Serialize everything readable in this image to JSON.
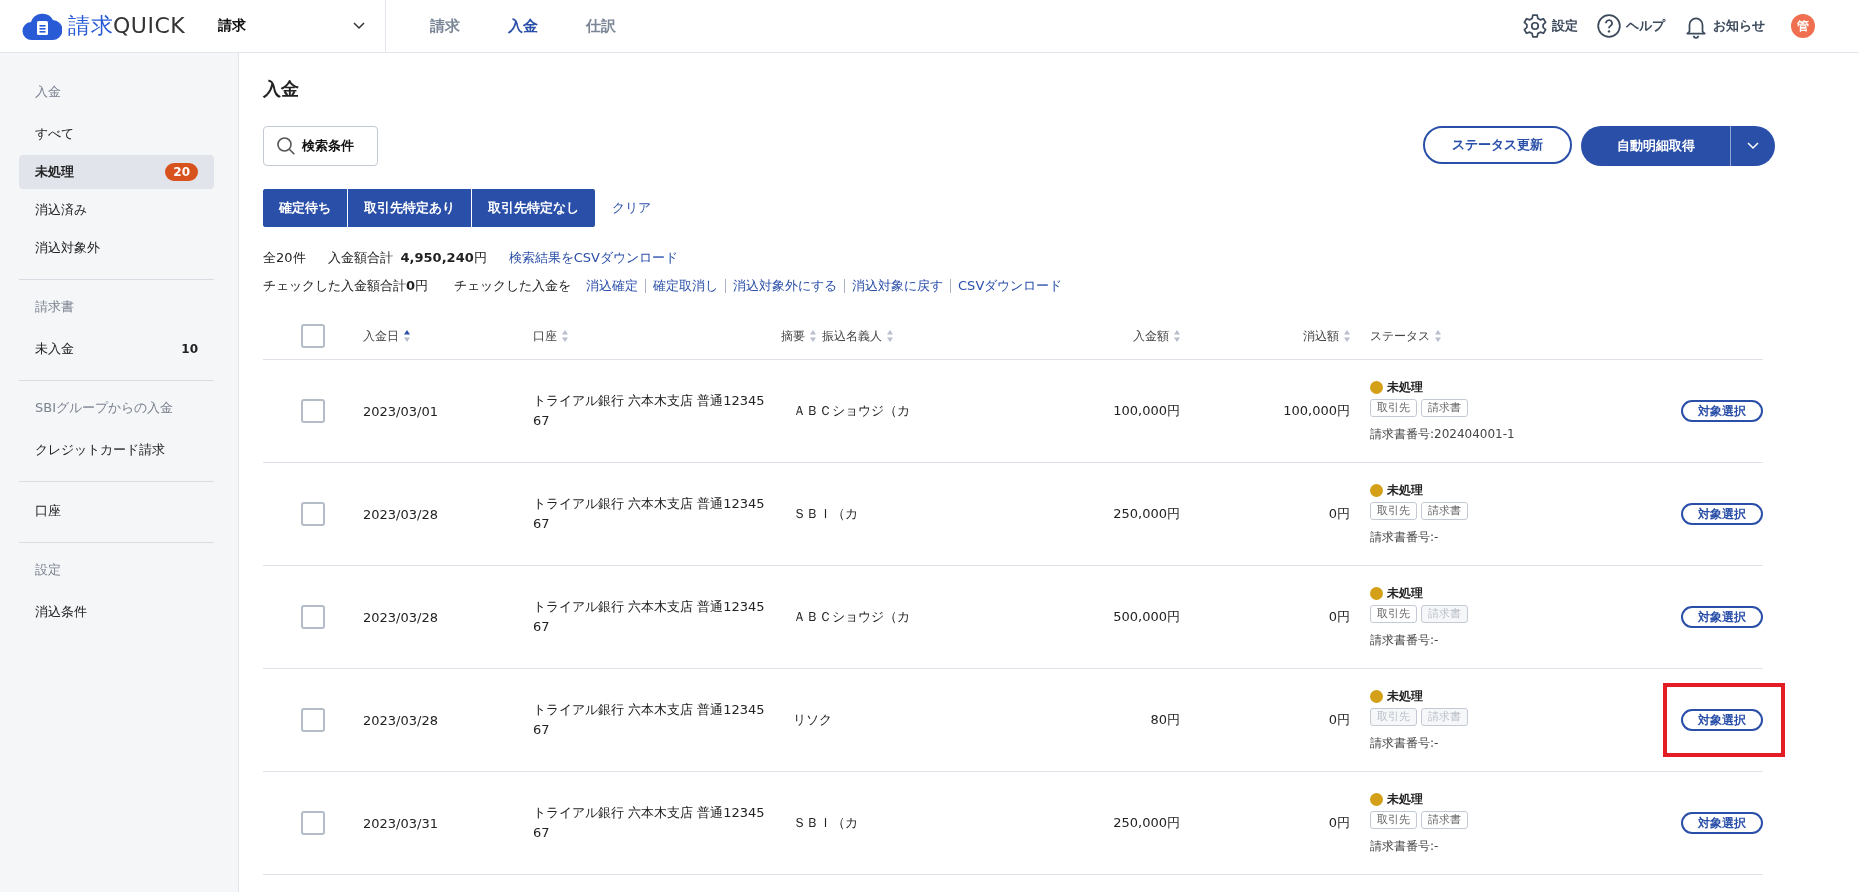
{
  "header": {
    "logo_primary": "請求",
    "logo_secondary": "QUICK",
    "product_select": "請求",
    "nav": [
      {
        "label": "請求",
        "selected": false
      },
      {
        "label": "入金",
        "selected": true
      },
      {
        "label": "仕訳",
        "selected": false
      }
    ],
    "actions": [
      {
        "kind": "settings",
        "label": "設定"
      },
      {
        "kind": "help",
        "label": "ヘルプ"
      },
      {
        "kind": "bell",
        "label": "お知らせ"
      }
    ],
    "avatar": "管"
  },
  "sidebar": {
    "sections": [
      {
        "heading": "入金",
        "items": [
          {
            "label": "すべて",
            "selected": false
          },
          {
            "label": "未処理",
            "selected": true,
            "badge": "20"
          },
          {
            "label": "消込済み",
            "selected": false
          },
          {
            "label": "消込対象外",
            "selected": false
          }
        ]
      },
      {
        "heading": "請求書",
        "items": [
          {
            "label": "未入金",
            "selected": false,
            "count": "10"
          }
        ]
      },
      {
        "heading": "SBIグループからの入金",
        "items": [
          {
            "label": "クレジットカード請求",
            "selected": false
          }
        ]
      },
      {
        "items": [
          {
            "label": "口座",
            "selected": false
          }
        ]
      },
      {
        "heading": "設定",
        "items": [
          {
            "label": "消込条件",
            "selected": false
          }
        ]
      }
    ]
  },
  "page_title": "入金",
  "search_button": "検索条件",
  "status_update_button": "ステータス更新",
  "auto_fetch_button": "自動明細取得",
  "filters": [
    {
      "label": "確定待ち",
      "selected": true
    },
    {
      "label": "取引先特定あり",
      "selected": true
    },
    {
      "label": "取引先特定なし",
      "selected": true
    }
  ],
  "clear_link": "クリア",
  "summary": {
    "total_count": "全20件",
    "amount_label": "入金額合計",
    "amount": "4,950,240",
    "amount_unit": "円",
    "csv_link": "検索結果をCSVダウンロード",
    "checked_label": "チェックした入金額合計",
    "checked_amount": "0",
    "checked_unit": "円",
    "checked_action_label": "チェックした入金を",
    "actions": [
      "消込確定",
      "確定取消し",
      "消込対象外にする",
      "消込対象に戻す",
      "CSVダウンロード"
    ]
  },
  "table": {
    "columns": [
      {
        "label": "入金日",
        "sorted_ascending": true
      },
      {
        "label": "口座",
        "sorted_ascending": false
      },
      {
        "label": "摘要",
        "sorted_ascending": false,
        "extra_label": "振込名義人"
      },
      {
        "label": "入金額",
        "sorted_ascending": false
      },
      {
        "label": "消込額",
        "sorted_ascending": false
      },
      {
        "label": "ステータス",
        "sorted_ascending": false
      }
    ],
    "header_checked": false,
    "rows": [
      {
        "checked": false,
        "date": "2023/03/01",
        "account": "トライアル銀行 六本木支店 普通1234567",
        "payer": "ＡＢＣショウジ（カ",
        "amount": "100,000円",
        "applied": "100,000円",
        "status": "未処理",
        "color": "#d4a017",
        "tags": [
          {
            "label": "取引先",
            "disabled": false
          },
          {
            "label": "請求書",
            "disabled": false
          }
        ],
        "invoice_no": "請求書番号:202404001-1",
        "button": "対象選択",
        "highlighted": false
      },
      {
        "checked": false,
        "date": "2023/03/28",
        "account": "トライアル銀行 六本木支店 普通1234567",
        "payer": "ＳＢＩ（カ",
        "amount": "250,000円",
        "applied": "0円",
        "status": "未処理",
        "color": "#d4a017",
        "tags": [
          {
            "label": "取引先",
            "disabled": false
          },
          {
            "label": "請求書",
            "disabled": false
          }
        ],
        "invoice_no": "請求書番号:-",
        "button": "対象選択",
        "highlighted": false
      },
      {
        "checked": false,
        "date": "2023/03/28",
        "account": "トライアル銀行 六本木支店 普通1234567",
        "payer": "ＡＢＣショウジ（カ",
        "amount": "500,000円",
        "applied": "0円",
        "status": "未処理",
        "color": "#d4a017",
        "tags": [
          {
            "label": "取引先",
            "disabled": false
          },
          {
            "label": "請求書",
            "disabled": true
          }
        ],
        "invoice_no": "請求書番号:-",
        "button": "対象選択",
        "highlighted": false
      },
      {
        "checked": false,
        "date": "2023/03/28",
        "account": "トライアル銀行 六本木支店 普通1234567",
        "payer": "リソク",
        "amount": "80円",
        "applied": "0円",
        "status": "未処理",
        "color": "#d4a017",
        "tags": [
          {
            "label": "取引先",
            "disabled": true
          },
          {
            "label": "請求書",
            "disabled": true
          }
        ],
        "invoice_no": "請求書番号:-",
        "button": "対象選択",
        "highlighted": true
      },
      {
        "checked": false,
        "date": "2023/03/31",
        "account": "トライアル銀行 六本木支店 普通1234567",
        "payer": "ＳＢＩ（カ",
        "amount": "250,000円",
        "applied": "0円",
        "status": "未処理",
        "color": "#d4a017",
        "tags": [
          {
            "label": "取引先",
            "disabled": false
          },
          {
            "label": "請求書",
            "disabled": false
          }
        ],
        "invoice_no": "請求書番号:-",
        "button": "対象選択",
        "highlighted": false
      }
    ]
  }
}
